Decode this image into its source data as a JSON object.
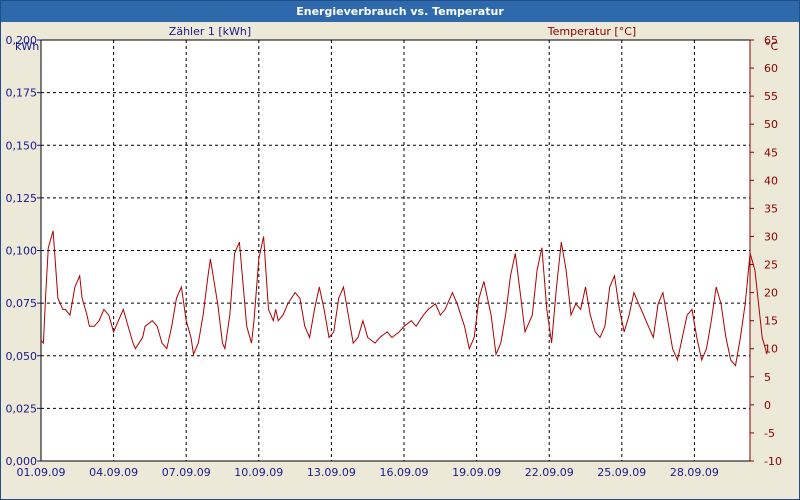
{
  "window": {
    "title": "Energieverbrauch vs. Temperatur"
  },
  "colors": {
    "left_axis": "#1A1A8C",
    "right_axis": "#8B0000",
    "plot_bg": "#FFFFFF",
    "grid": "#000000",
    "frame_bg": "#ECE9D8"
  },
  "chart_data": {
    "type": "line",
    "title": "Energieverbrauch vs. Temperatur",
    "grid": true,
    "x_tick_labels": [
      "01.09.09",
      "04.09.09",
      "07.09.09",
      "10.09.09",
      "13.09.09",
      "16.09.09",
      "19.09.09",
      "22.09.09",
      "25.09.09",
      "28.09.09"
    ],
    "x_range": [
      "01.09.09",
      "30.09.09"
    ],
    "y_left": {
      "unit": "kWh",
      "min": 0,
      "max": 0.2,
      "ticks": [
        "0,000",
        "0,025",
        "0,050",
        "0,075",
        "0,100",
        "0,125",
        "0,150",
        "0,175",
        "0,200"
      ]
    },
    "y_right": {
      "unit": "°C",
      "min": -10,
      "max": 65,
      "ticks": [
        "-10",
        "-5",
        "0",
        "5",
        "10",
        "15",
        "20",
        "25",
        "30",
        "35",
        "40",
        "45",
        "50",
        "55",
        "60",
        "65"
      ]
    },
    "legend": {
      "series_left": "Zähler 1 [kWh]",
      "series_right": "Temperatur [°C]"
    },
    "series": [
      {
        "name": "Temperatur [°C]",
        "axis": "right",
        "x_days": [
          0,
          0.1,
          0.2,
          0.3,
          0.5,
          0.7,
          0.9,
          1.0,
          1.2,
          1.4,
          1.6,
          1.7,
          1.9,
          2.0,
          2.2,
          2.4,
          2.6,
          2.8,
          3.0,
          3.2,
          3.4,
          3.6,
          3.8,
          3.9,
          4.2,
          4.3,
          4.6,
          4.8,
          5.0,
          5.2,
          5.4,
          5.6,
          5.8,
          6.0,
          6.2,
          6.3,
          6.5,
          6.7,
          6.9,
          7.0,
          7.3,
          7.5,
          7.6,
          7.8,
          8.0,
          8.2,
          8.4,
          8.5,
          8.7,
          8.8,
          9.0,
          9.2,
          9.4,
          9.6,
          9.7,
          9.8,
          10.0,
          10.2,
          10.5,
          10.7,
          10.9,
          11.1,
          11.3,
          11.5,
          11.7,
          11.9,
          12.1,
          12.3,
          12.5,
          12.7,
          12.9,
          13.1,
          13.3,
          13.5,
          13.8,
          14.0,
          14.3,
          14.5,
          14.8,
          15.0,
          15.3,
          15.5,
          15.8,
          16.0,
          16.3,
          16.5,
          16.7,
          17.0,
          17.2,
          17.5,
          17.7,
          17.9,
          18.1,
          18.3,
          18.6,
          18.8,
          19.0,
          19.2,
          19.4,
          19.6,
          19.8,
          20.0,
          20.3,
          20.5,
          20.7,
          20.9,
          21.1,
          21.3,
          21.5,
          21.7,
          21.9,
          22.1,
          22.3,
          22.5,
          22.7,
          22.9,
          23.1,
          23.3,
          23.5,
          23.7,
          23.9,
          24.1,
          24.3,
          24.5,
          24.7,
          24.9,
          25.1,
          25.3,
          25.5,
          25.7,
          25.9,
          26.1,
          26.3,
          26.5,
          26.7,
          26.9,
          27.1,
          27.3,
          27.5,
          27.7,
          27.9,
          28.1,
          28.3,
          28.5,
          28.7,
          28.9,
          29.1,
          29.3,
          29.5,
          29.8,
          30.0
        ],
        "values": [
          11.5,
          11,
          20,
          28,
          31,
          19,
          17,
          17,
          16,
          21,
          23,
          19,
          16,
          14,
          14,
          15,
          17,
          16,
          13,
          15,
          17,
          14,
          11,
          10,
          12,
          14,
          15,
          14,
          11,
          10,
          14,
          19,
          21,
          15,
          12,
          9,
          11,
          16,
          23,
          26,
          18,
          11,
          10,
          16,
          27,
          29,
          19,
          14,
          11,
          15,
          26,
          30,
          17,
          15,
          17,
          15,
          16,
          18,
          20,
          19,
          14,
          12,
          17,
          21,
          17,
          12,
          13,
          19,
          21,
          16,
          11,
          12,
          15,
          12,
          11,
          12,
          13,
          12,
          13,
          14,
          15,
          14,
          16,
          17,
          18,
          16,
          17,
          20,
          18,
          14,
          10,
          12,
          19,
          22,
          16,
          9,
          11,
          16,
          23,
          27,
          20,
          13,
          16,
          24,
          28,
          17,
          11,
          21,
          29,
          24,
          16,
          18,
          17,
          21,
          16,
          13,
          12,
          14,
          21,
          23,
          17,
          13,
          16,
          20,
          18,
          16,
          14,
          12,
          18,
          20,
          15,
          10,
          8,
          12,
          16,
          17,
          12,
          8,
          10,
          15,
          21,
          18,
          12,
          8,
          7,
          12,
          18,
          27,
          24,
          12,
          9,
          10,
          17,
          15,
          16,
          15,
          16,
          18,
          17,
          14,
          11,
          9,
          13,
          15,
          15
        ]
      }
    ]
  }
}
